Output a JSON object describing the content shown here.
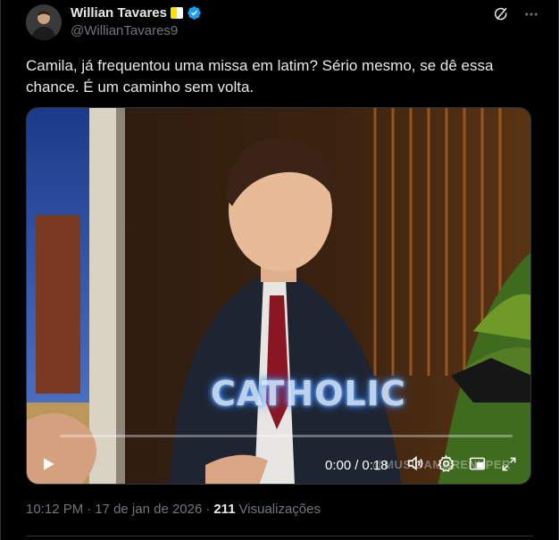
{
  "author": {
    "name": "Willian Tavares",
    "handle": "@WillianTavares9",
    "flag_icon": "vatican-flag-icon",
    "verified_icon": "verified-badge-icon",
    "verified_color": "#1d9bf0"
  },
  "tweet": {
    "text": "Camila, já frequentou uma missa em latim? Sério mesmo, se dê essa chance. É um caminho sem volta."
  },
  "video": {
    "caption": "CATHOLIC",
    "current_time": "0:00",
    "separator": "/",
    "duration": "0:18",
    "watermark": "@MUSICAMBRENYPER",
    "progress": 0
  },
  "meta": {
    "time": "10:12 PM",
    "date": "17 de jan de 2026",
    "dot": "·",
    "views_count": "211",
    "views_label": "Visualizações"
  },
  "colors": {
    "background": "#000000",
    "text": "#e7e9ea",
    "muted": "#71767b",
    "border": "#2f3336"
  }
}
